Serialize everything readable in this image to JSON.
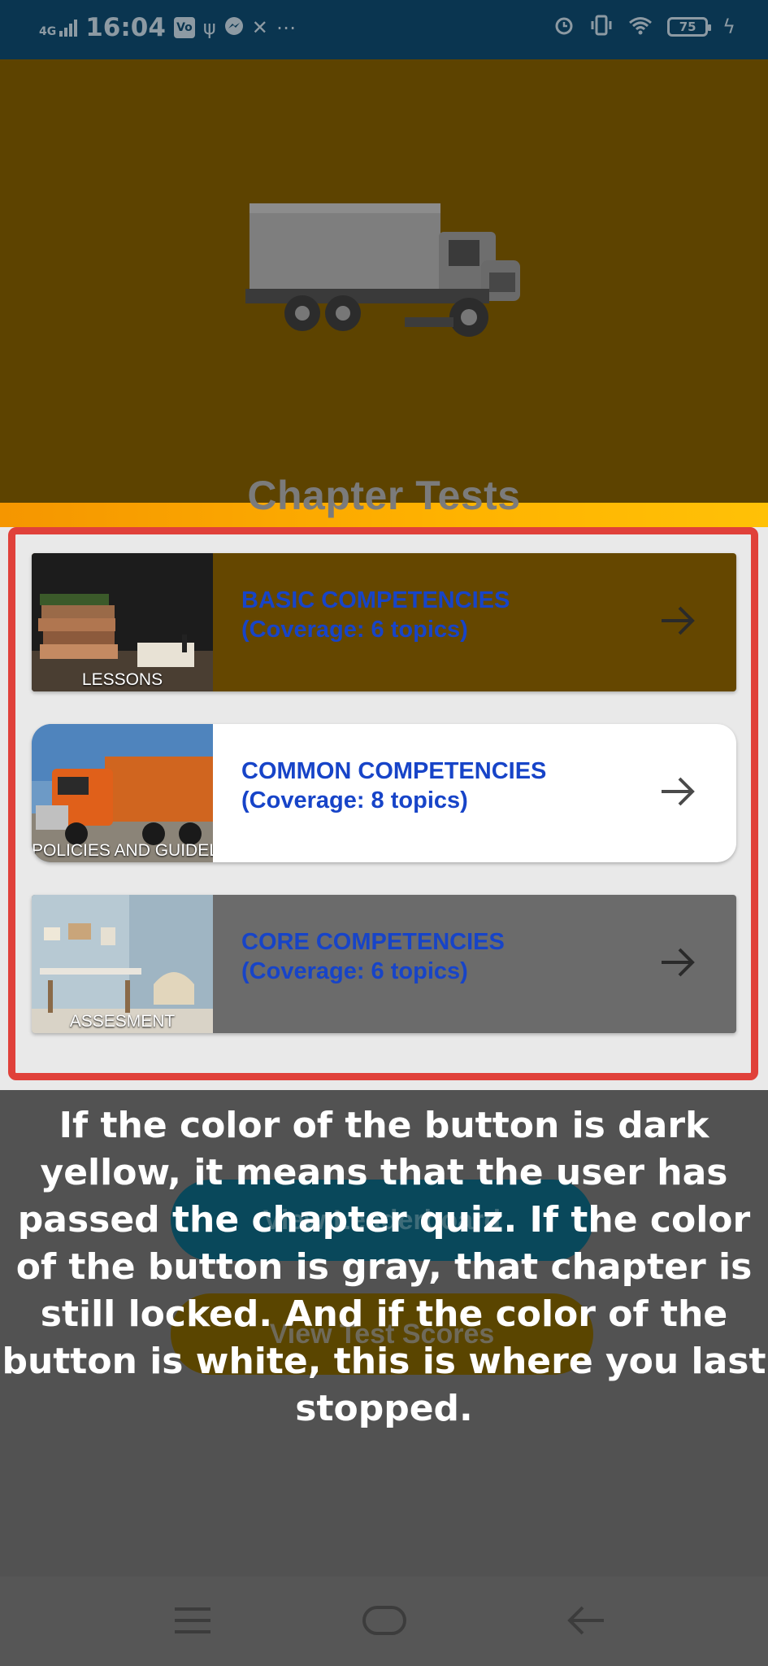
{
  "status_bar": {
    "time": "16:04",
    "network": "4G",
    "battery": "75",
    "icons_left": [
      "signal-icon",
      "volte-icon",
      "usb-icon",
      "messenger-icon",
      "tools-icon",
      "more-icon"
    ],
    "icons_right": [
      "alarm-icon",
      "vibrate-icon",
      "wifi-icon",
      "battery-icon",
      "charging-icon"
    ]
  },
  "header": {
    "title": "Chapter Tests"
  },
  "chapters": [
    {
      "title": "BASIC COMPETENCIES",
      "coverage": "(Coverage: 6 topics)",
      "thumb_label": "LESSONS",
      "state": "passed"
    },
    {
      "title": "COMMON COMPETENCIES",
      "coverage": "(Coverage: 8 topics)",
      "thumb_label": "POLICIES AND GUIDELINES",
      "state": "current"
    },
    {
      "title": "CORE COMPETENCIES",
      "coverage": "(Coverage: 6 topics)",
      "thumb_label": "ASSESMENT",
      "state": "locked"
    }
  ],
  "buttons": {
    "leaderboard": "View Leaderboard",
    "test_scores": "View Test Scores"
  },
  "tutorial_overlay": {
    "text": "If the color of the button is dark yellow, it means that the user has passed the chapter quiz. If the color of the button is gray, that chapter is still locked. And if the color of the button is white, this is where you last stopped."
  },
  "colors": {
    "passed": "#654700",
    "current": "#ffffff",
    "locked": "#6b6b6b",
    "highlight": "#e0413a",
    "link_text": "#1744c8"
  }
}
